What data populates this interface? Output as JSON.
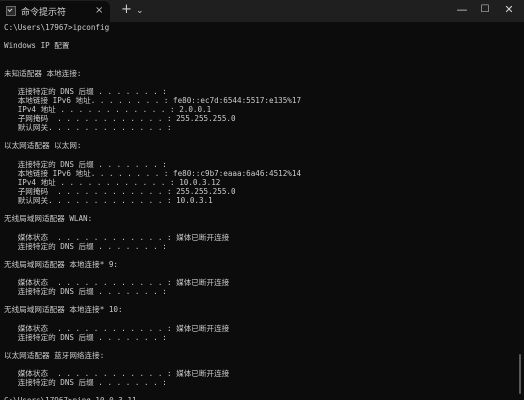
{
  "window": {
    "tab_title": "命令提示符",
    "tab_close_icon": "×",
    "new_tab_icon": "+",
    "dropdown_icon": "⌄",
    "minimize_icon": "—",
    "maximize_icon": "☐",
    "close_icon": "✕"
  },
  "terminal": {
    "lines": [
      "C:\\Users\\17967>ipconfig",
      "",
      "Windows IP 配置",
      "",
      "",
      "未知适配器 本地连接:",
      "",
      "   连接特定的 DNS 后缀 . . . . . . . :",
      "   本地链接 IPv6 地址. . . . . . . . : fe80::ec7d:6544:5517:e135%17",
      "   IPv4 地址 . . . . . . . . . . . . : 2.0.0.1",
      "   子网掩码  . . . . . . . . . . . . : 255.255.255.0",
      "   默认网关. . . . . . . . . . . . . :",
      "",
      "以太网适配器 以太网:",
      "",
      "   连接特定的 DNS 后缀 . . . . . . . :",
      "   本地链接 IPv6 地址. . . . . . . . : fe80::c9b7:eaaa:6a46:4512%14",
      "   IPv4 地址 . . . . . . . . . . . . : 10.0.3.12",
      "   子网掩码  . . . . . . . . . . . . : 255.255.255.0",
      "   默认网关. . . . . . . . . . . . . : 10.0.3.1",
      "",
      "无线局域网适配器 WLAN:",
      "",
      "   媒体状态  . . . . . . . . . . . . : 媒体已断开连接",
      "   连接特定的 DNS 后缀 . . . . . . . :",
      "",
      "无线局域网适配器 本地连接* 9:",
      "",
      "   媒体状态  . . . . . . . . . . . . : 媒体已断开连接",
      "   连接特定的 DNS 后缀 . . . . . . . :",
      "",
      "无线局域网适配器 本地连接* 10:",
      "",
      "   媒体状态  . . . . . . . . . . . . : 媒体已断开连接",
      "   连接特定的 DNS 后缀 . . . . . . . :",
      "",
      "以太网适配器 蓝牙网络连接:",
      "",
      "   媒体状态  . . . . . . . . . . . . : 媒体已断开连接",
      "   连接特定的 DNS 后缀 . . . . . . . :",
      "",
      "C:\\Users\\17967>ping 10.0.3.11"
    ]
  }
}
